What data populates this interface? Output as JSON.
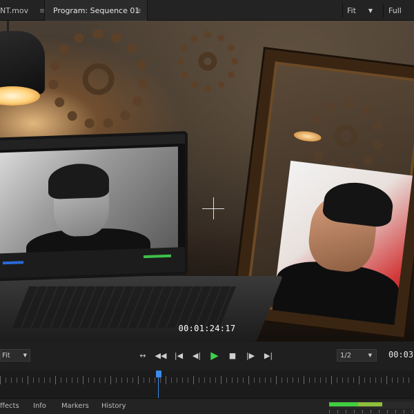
{
  "tabs": [
    {
      "label": "NT.mov",
      "menu": "≡"
    },
    {
      "label": "Program: Sequence 01",
      "menu": "≡"
    }
  ],
  "top_controls": {
    "fit_label": "Fit",
    "full_label": "Full",
    "caret": "▼"
  },
  "viewer": {
    "timecode": "00:01:24:17"
  },
  "controls": {
    "fit_label": "Fit",
    "resolution": "1/2",
    "timecode": "00:03:",
    "caret": "▼",
    "transport": [
      {
        "name": "mark-in-out-button",
        "icon": "↔"
      },
      {
        "name": "step-back-button",
        "icon": "◀◀"
      },
      {
        "name": "go-to-in-button",
        "icon": "|◀"
      },
      {
        "name": "step-back-frame-button",
        "icon": "◀|"
      },
      {
        "name": "play-button",
        "icon": "▶"
      },
      {
        "name": "stop-button",
        "icon": "■"
      },
      {
        "name": "step-forward-frame-button",
        "icon": "|▶"
      },
      {
        "name": "go-to-out-button",
        "icon": "▶|"
      }
    ]
  },
  "bottom_tabs": [
    "ffects",
    "Info",
    "Markers",
    "History"
  ],
  "colors": {
    "play": "#3ed04d",
    "playhead": "#3a8bea",
    "meter_green": "#3fcf3f"
  }
}
